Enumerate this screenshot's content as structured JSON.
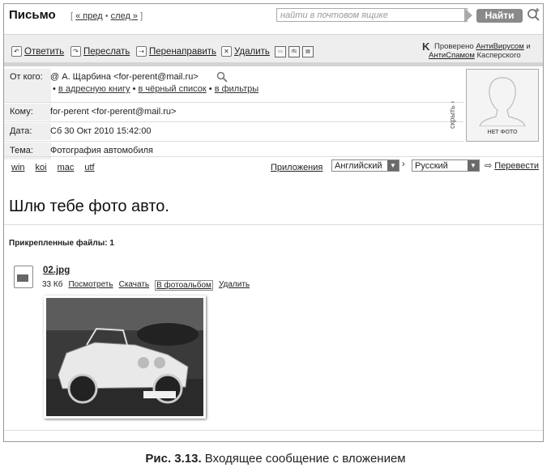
{
  "header": {
    "title": "Письмо",
    "nav_open": "[",
    "nav_prev": "« пред",
    "nav_dot": "•",
    "nav_next": "след »",
    "nav_close": "]",
    "search_placeholder": "найти в почтовом ящике",
    "search_button": "Найти"
  },
  "toolbar": {
    "reply": "Ответить",
    "forward": "Переслать",
    "redirect": "Перенаправить",
    "delete": "Удалить",
    "av_line1_a": "Проверено ",
    "av_line1_link": "АнтиВирусом",
    "av_line1_b": " и",
    "av_line2_link": "АнтиСпамом",
    "av_line2_b": " Касперского"
  },
  "message": {
    "from_label": "От кого:",
    "from_value": "А. Щарбина <for-perent@mail.ru>",
    "from_actions": [
      "в адресную книгу",
      "в чёрный список",
      "в фильтры"
    ],
    "to_label": "Кому:",
    "to_value": "for-perent <for-perent@mail.ru>",
    "date_label": "Дата:",
    "date_value": "Сб 30 Окт 2010 15:42:00",
    "subject_label": "Тема:",
    "subject_value": "Фотография автомобиля",
    "hide_label": "скрыть",
    "no_photo": "НЕТ ФОТО"
  },
  "encodings": [
    "win",
    "koi",
    "mac",
    "utf"
  ],
  "translate": {
    "apps_label": "Приложения",
    "from_lang": "Английский",
    "to_lang": "Русский",
    "button": "Перевести",
    "arrow": "›"
  },
  "body": {
    "text": "Шлю тебе фото авто."
  },
  "attachments": {
    "title": "Прикрепленные файлы: 1",
    "file_name": "02.jpg",
    "file_size": "33 Кб",
    "view": "Посмотреть",
    "download": "Скачать",
    "to_album": "В фотоальбом",
    "delete": "Удалить"
  },
  "caption": {
    "label": "Рис. 3.13.",
    "text": " Входящее сообщение с вложением"
  }
}
